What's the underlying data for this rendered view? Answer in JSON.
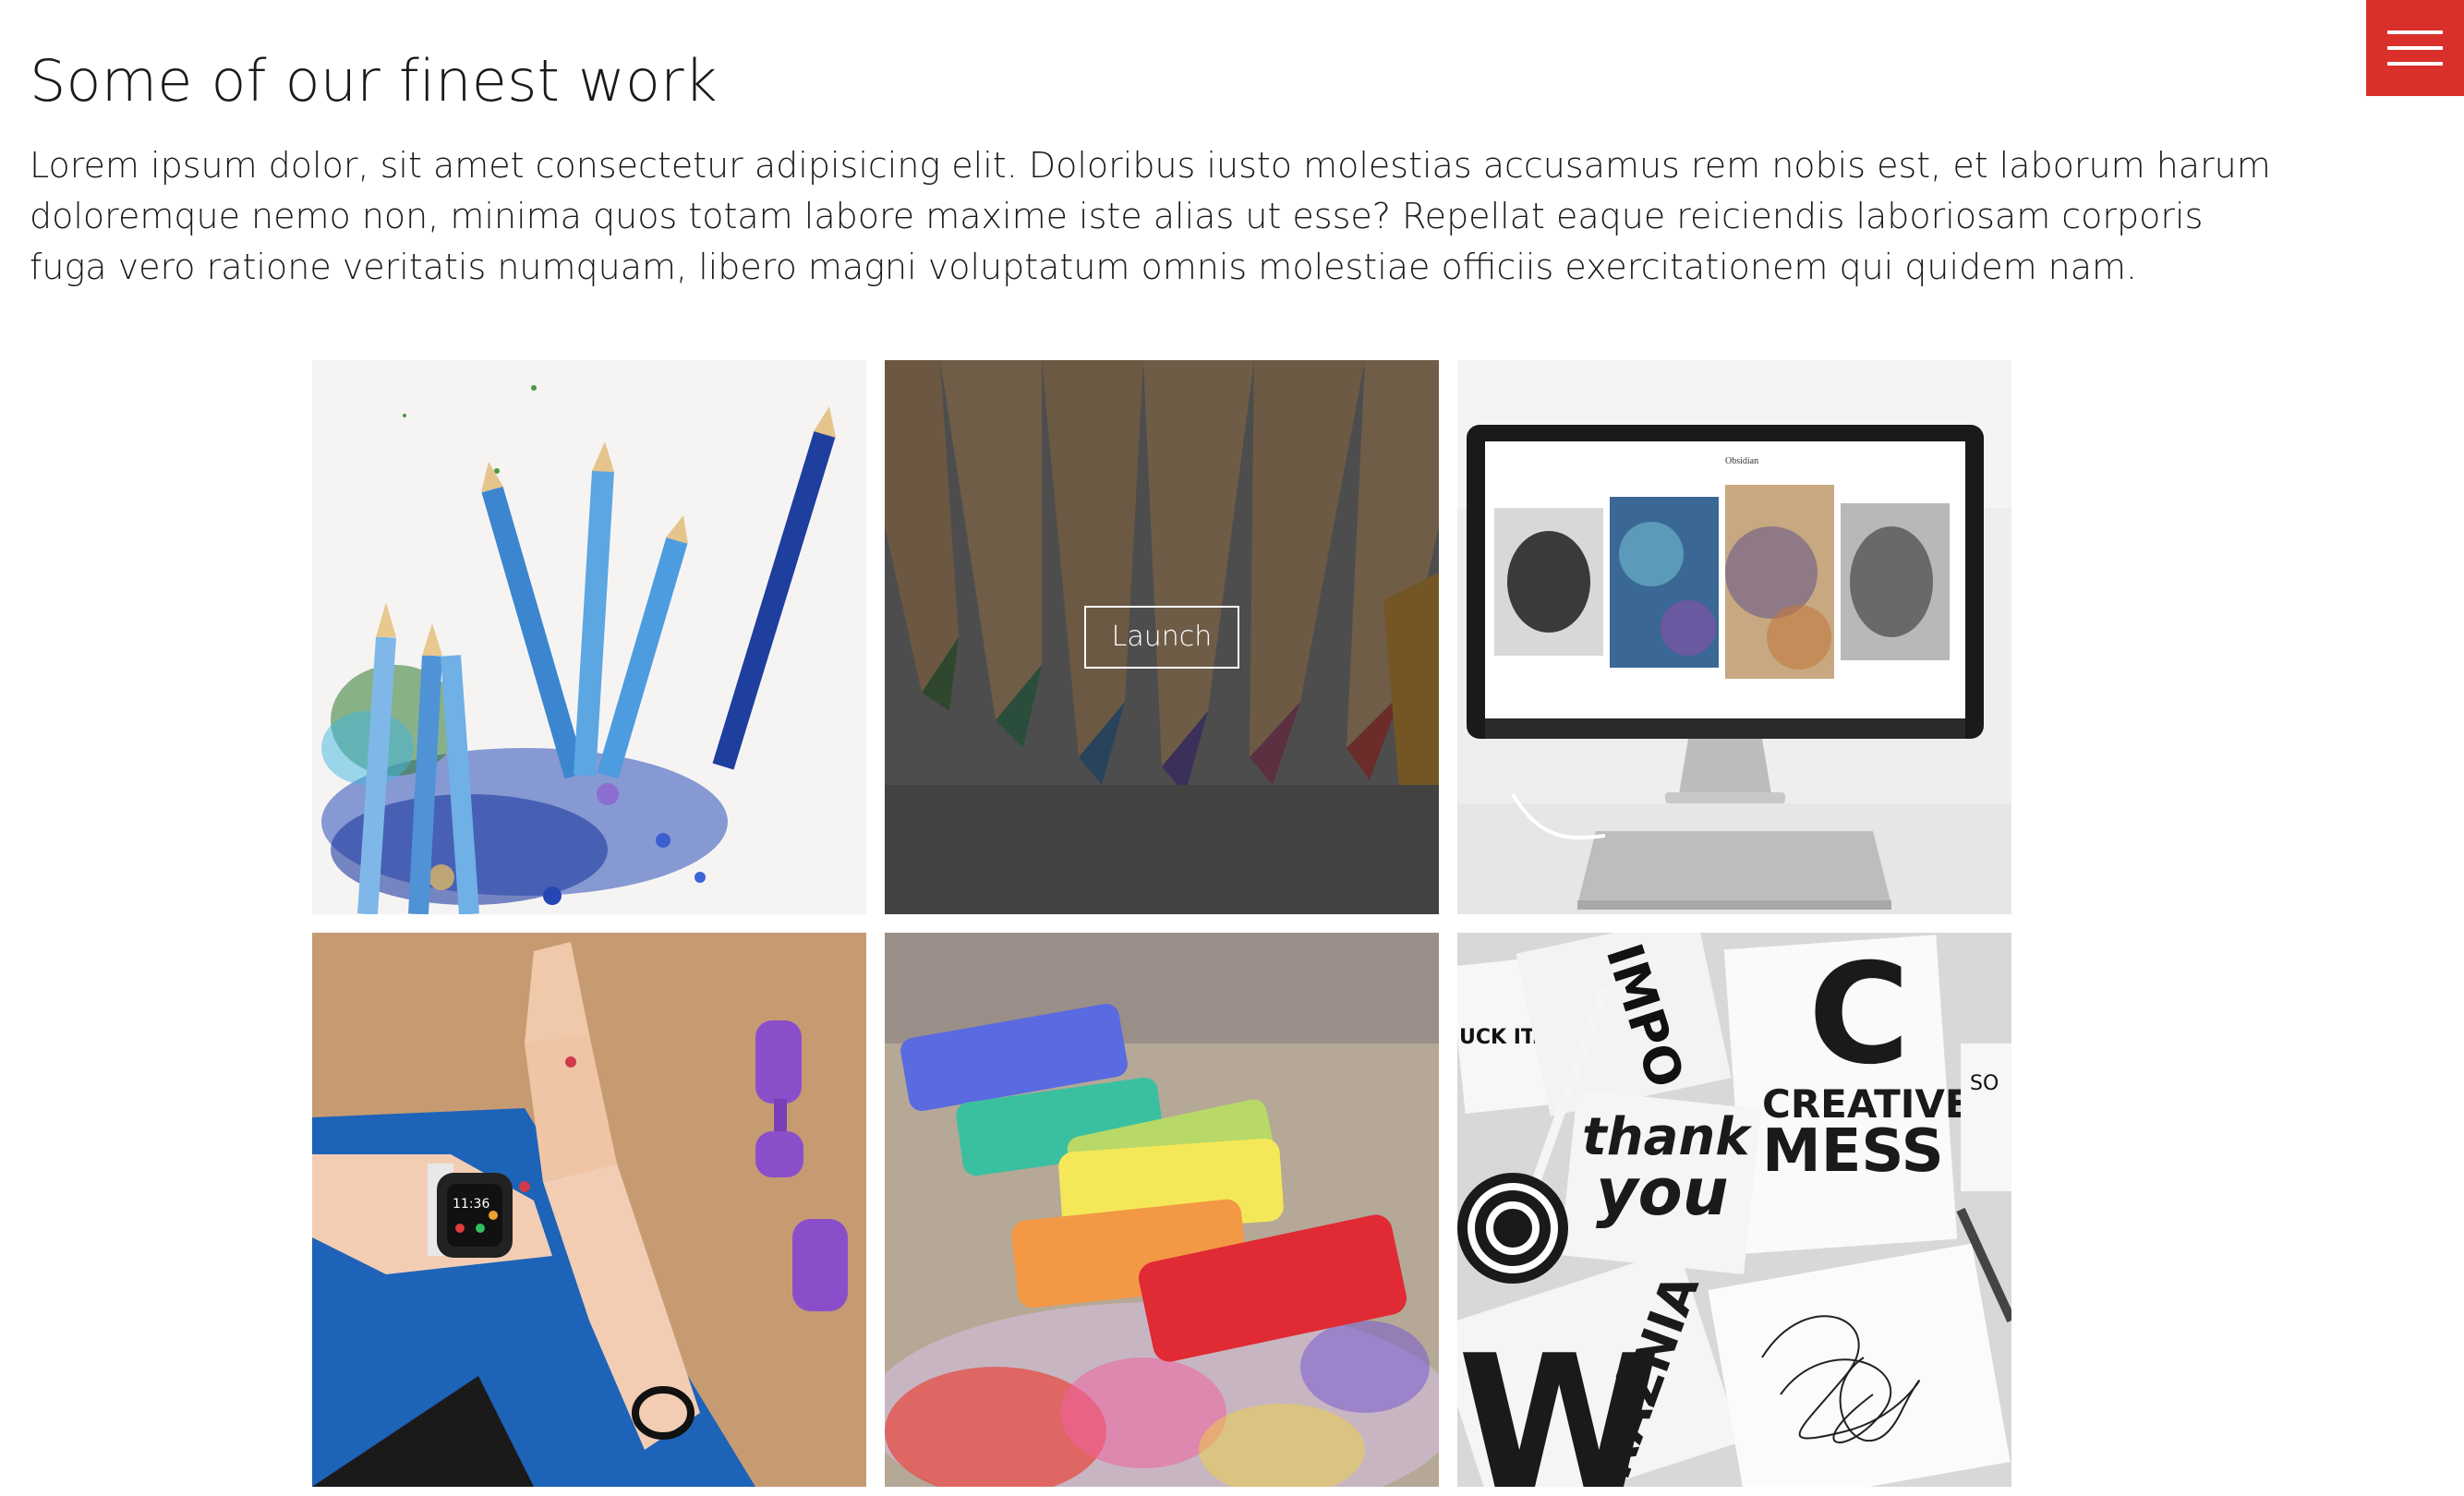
{
  "header": {
    "title": "Some of our finest work",
    "intro": "Lorem ipsum dolor, sit amet consectetur adipisicing elit. Doloribus iusto molestias accusamus rem nobis est, et laborum harum doloremque nemo non, minima quos totam labore maxime iste alias ut esse? Repellat eaque reiciendis laboriosam corporis fuga vero ratione veritatis numquam, libero magni voluptatum omnis molestiae officiis exercitationem qui quidem nam."
  },
  "menu": {
    "icon": "hamburger-menu-icon",
    "color": "#d9302c"
  },
  "gallery": {
    "items": [
      {
        "subject": "blue-pencils-shavings",
        "hovered": false
      },
      {
        "subject": "colored-pencil-tips",
        "hovered": true,
        "launch_label": "Launch"
      },
      {
        "subject": "monitor-on-desk",
        "hovered": false,
        "screen_title": "Obsidian"
      },
      {
        "subject": "smartwatch-wrist",
        "hovered": false,
        "watch_time": "11:36"
      },
      {
        "subject": "pastel-chalks",
        "hovered": false
      },
      {
        "subject": "creative-mess-posters",
        "hovered": false,
        "poster_letter": "C",
        "poster_line1": "CREATIVE",
        "poster_line2": "MESS",
        "poster_thank": "thank",
        "poster_you": "you",
        "poster_uck": "UCK IT.",
        "poster_so": "SO",
        "poster_w": "W",
        "poster_razn": "RAŹNIA",
        "poster_imp": "IMPO"
      }
    ]
  }
}
